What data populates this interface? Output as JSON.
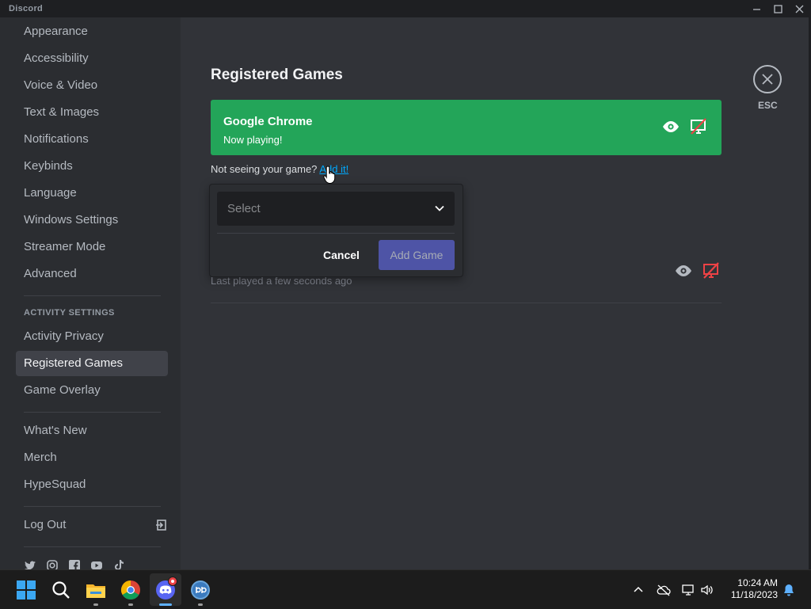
{
  "window": {
    "title": "Discord"
  },
  "sidebar": {
    "items": [
      {
        "label": "Appearance"
      },
      {
        "label": "Accessibility"
      },
      {
        "label": "Voice & Video"
      },
      {
        "label": "Text & Images"
      },
      {
        "label": "Notifications"
      },
      {
        "label": "Keybinds"
      },
      {
        "label": "Language"
      },
      {
        "label": "Windows Settings"
      },
      {
        "label": "Streamer Mode"
      },
      {
        "label": "Advanced"
      }
    ],
    "activity_header": "ACTIVITY SETTINGS",
    "activity_items": [
      {
        "label": "Activity Privacy"
      },
      {
        "label": "Registered Games",
        "selected": true
      },
      {
        "label": "Game Overlay"
      }
    ],
    "misc_items": [
      {
        "label": "What's New"
      },
      {
        "label": "Merch"
      },
      {
        "label": "HypeSquad"
      }
    ],
    "logout_label": "Log Out",
    "socials": [
      "twitter-icon",
      "instagram-icon",
      "facebook-icon",
      "youtube-icon",
      "tiktok-icon"
    ]
  },
  "main": {
    "title": "Registered Games",
    "now_playing": {
      "name": "Google Chrome",
      "status": "Now playing!",
      "color": "#23a559"
    },
    "not_seeing_text": "Not seeing your game?",
    "add_it_link": "Add it!",
    "last_played": "Last played a few seconds ago"
  },
  "popout": {
    "select_placeholder": "Select",
    "cancel_label": "Cancel",
    "add_game_label": "Add Game"
  },
  "close": {
    "esc_label": "ESC"
  },
  "taskbar": {
    "apps": [
      "windows-start-icon",
      "search-icon",
      "file-explorer-icon",
      "chrome-icon",
      "discord-icon",
      "qbittorrent-icon"
    ],
    "time": "10:24 AM",
    "date": "11/18/2023"
  }
}
